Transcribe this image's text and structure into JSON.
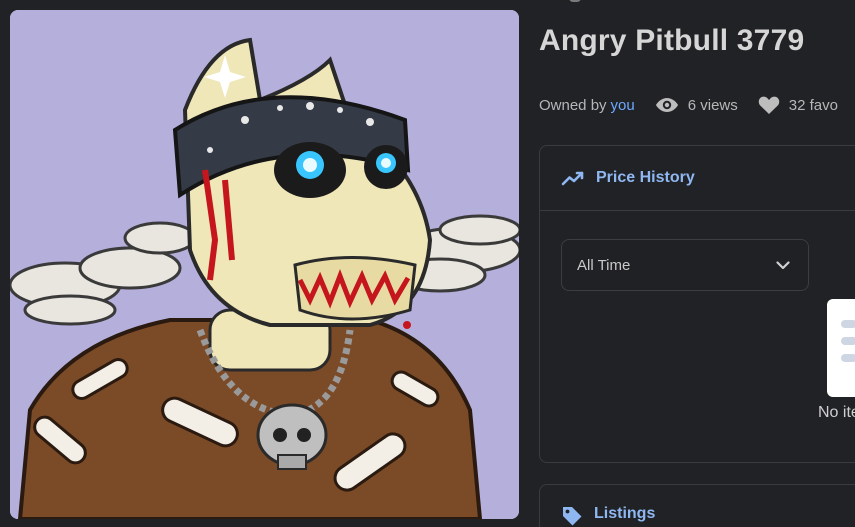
{
  "item": {
    "title": "Angry Pitbull 3779",
    "owned_by_label": "Owned by",
    "owner": "you",
    "views": "6 views",
    "favorites": "32 favo"
  },
  "price_history": {
    "header": "Price History",
    "time_filter": {
      "selected": "All Time"
    },
    "empty_text": "No ite"
  },
  "listings": {
    "header": "Listings"
  },
  "icons": {
    "views": "eye-icon",
    "favorites": "heart-icon",
    "price_history": "trending-up-icon",
    "listings": "tag-icon",
    "dropdown": "chevron-down-icon"
  },
  "colors": {
    "page_background": "#202225",
    "art_background": "#b5afdc",
    "accent_link": "#6ea8fe",
    "panel_header": "#8fb8f2",
    "panel_border": "#3a3b3e"
  }
}
